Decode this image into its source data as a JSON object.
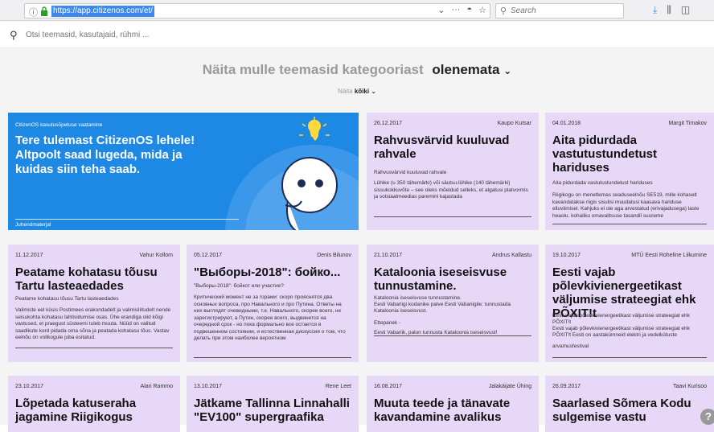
{
  "browser": {
    "url": "https://app.citizenos.com/et/",
    "search_placeholder": "Search"
  },
  "site": {
    "search_placeholder": "Otsi teemasid, kasutajaid, rühmi ..."
  },
  "category": {
    "title": "Näita mulle teemasid kategooriast",
    "value": "olenemata",
    "filter_label": "Näita",
    "filter_value": "kõiki"
  },
  "featured": {
    "meta": "CitizenOS kasutusõpetuse vaatamine",
    "title": "Tere tulemast CitizenOS lehele! Altpoolt saad lugeda, mida ja kuidas siin teha saab.",
    "footer": "Juhendmaterjal"
  },
  "cards": [
    {
      "date": "26.12.2017",
      "author": "Kaupo Kutsar",
      "title": "Rahvusvärvid kuuluvad rahvale",
      "sub": "Rahvusvärvid kuuluvad rahvale",
      "body": "Lühike (u 350 tähemärki) või säutsu-lühike (140 tähemärki) sissukokkuvõte – see oleks mõeldud selleks, et algatusi platvormis ja sotsiaalmeedias paremini kajastada",
      "foot": "",
      "foot2": ""
    },
    {
      "date": "04.01.2018",
      "author": "Margit Timakov",
      "title": "Aita pidurdada vastutustundetust hariduses",
      "sub": "Aita pidurdada vastutustundetust hariduses",
      "body": "Riigikogu on menetlemas seaduseelnõu SE519, mille kohaselt kavandatakse riigis sisulisi muudatusi kaasava hariduse elluviimisel. Kahjuks ei ole aga arvestatud (erivajadusega) laste heaolu, kohaliku omavalitsuse tasandil suureme",
      "foot": "",
      "foot2": ""
    },
    {
      "date": "11.12.2017",
      "author": "Vahur Kollom",
      "title": "Peatame kohatasu tõusu Tartu lasteaedades",
      "sub": "Peatame kohatasu tõusu Tartu lasteaedades",
      "body": "Valimiste eel küsis Postimees erakondadelt ja valimisliitudelt nende seisukohta kohatasu lahtisidumise osas. Ühe erandiga olid kõigi vastused, et praegust süsteemi tuleb muuta. Nüüd on valitud saadikute kord pidada oma sõna ja peatada kohatasu tõus. Vastav eelnõu on volikogule juba esitatud.",
      "foot": "",
      "foot2": ""
    },
    {
      "date": "05.12.2017",
      "author": "Denis Bilunov",
      "title": "\"Выборы-2018\": бойко...",
      "sub": "\"Выборы-2018\": бойкот или участие?",
      "body": "Критический момент не за горами: скоро прояснятся два основных вопроса, про Навального и про Путина. Ответы на них выглядят очевидными, т.е. Навального, скорее всего, не зарегистрируют, а Путин, скорее всего, выдвинется на очередной срок - но пока формально все остается в подвешенном состоянии, и естественная дискуссия о том, что делать при этом наиболее вероятном",
      "foot": "",
      "foot2": ""
    },
    {
      "date": "21.10.2017",
      "author": "Andrus Kallastu",
      "title": "Kataloonia iseseisvuse tunnustamine.",
      "sub": "Kataloonia iseseisvuse tunnustamine.\nEesti Vabariigi kodanike palve Eesti Vabariigile: tunnustada Kataloonia iseseisvust.",
      "body": "",
      "foot": "Ettepanek -",
      "foot2": "Eesti Vabariik, palun tunnusta Kataloonia iseseisvust!"
    },
    {
      "date": "19.10.2017",
      "author": "MTÜ Eesti Roheline Liikumine",
      "title": "Eesti vajab põlevkivienergeetikast väljumise strateegiat ehk PÕXIT!t",
      "sub": "Eesti vajab põlevkivienergeetikast väljumise strateegiat ehk PÕXIT!t\nEesti vajab põlevkivienergeetikast väljumise strateegiat ehk PÕXIT!t Eesti on aastakümneid elektri ja vedelkütuste",
      "body": "",
      "foot": "arvamusfestival",
      "foot2": ""
    },
    {
      "date": "23.10.2017",
      "author": "Alari Rammo",
      "title": "Lõpetada katuseraha jagamine Riigikogus",
      "sub": "",
      "body": "",
      "foot": "",
      "foot2": ""
    },
    {
      "date": "13.10.2017",
      "author": "Rene Leet",
      "title": "Jätkame Tallinna Linnahalli \"EV100\" supergraafika",
      "sub": "",
      "body": "",
      "foot": "",
      "foot2": ""
    },
    {
      "date": "16.08.2017",
      "author": "Jalakäijate Ühing",
      "title": "Muuta teede ja tänavate kavandamine avalikus",
      "sub": "",
      "body": "",
      "foot": "",
      "foot2": ""
    },
    {
      "date": "26.09.2017",
      "author": "Taavi Kurisoo",
      "title": "Saarlased Sõmera Kodu sulgemise vastu",
      "sub": "",
      "body": "",
      "foot": "",
      "foot2": ""
    }
  ],
  "help_label": "?",
  "colors": {
    "card_bg": "#e8d8f8",
    "featured_bg": "#1e88e5",
    "accent": "#3d89f0"
  }
}
